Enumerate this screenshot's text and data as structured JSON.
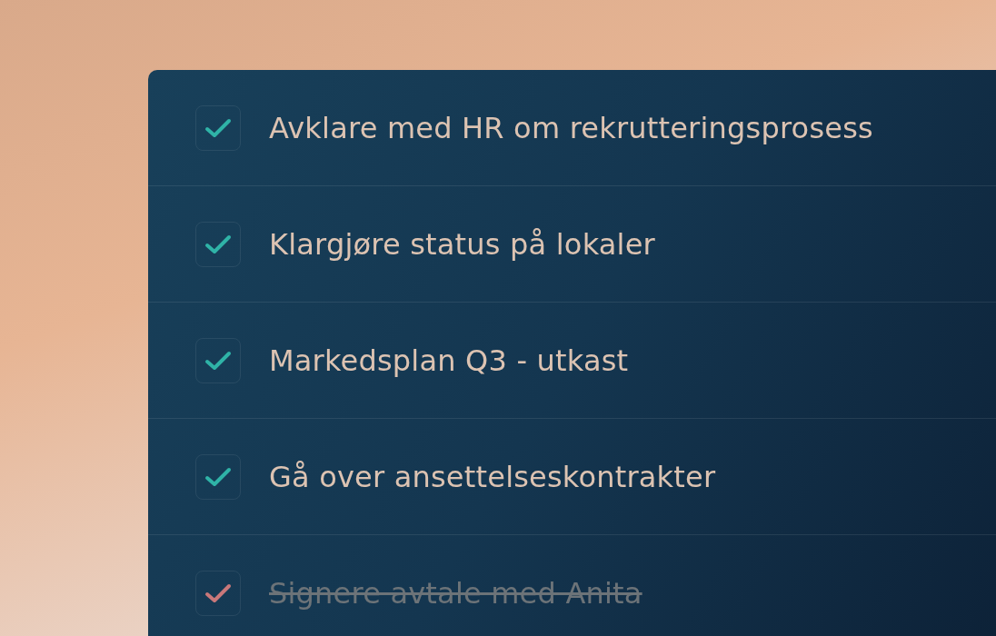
{
  "tasks": [
    {
      "label": "Avklare med HR om rekrutteringsprosess",
      "checked": true,
      "crossed_out": false
    },
    {
      "label": "Klargjøre status på lokaler",
      "checked": true,
      "crossed_out": false
    },
    {
      "label": "Markedsplan Q3 - utkast",
      "checked": true,
      "crossed_out": false
    },
    {
      "label": "Gå over ansettelseskontrakter",
      "checked": true,
      "crossed_out": false
    },
    {
      "label": "Signere avtale med Anita",
      "checked": true,
      "crossed_out": true
    }
  ]
}
